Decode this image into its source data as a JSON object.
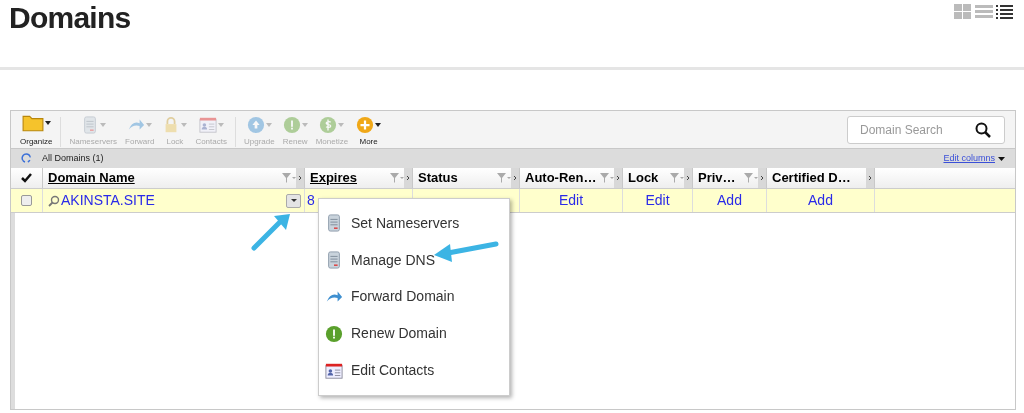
{
  "page": {
    "title": "Domains"
  },
  "view_toggles": [
    {
      "kind": "grid",
      "selected": false
    },
    {
      "kind": "list",
      "selected": false
    },
    {
      "kind": "detail",
      "selected": true
    }
  ],
  "toolbar": {
    "buttons": [
      {
        "kind": "folder",
        "label": "Organize",
        "disabled": false
      },
      {
        "kind": "server",
        "label": "Nameservers",
        "disabled": true
      },
      {
        "kind": "forward",
        "label": "Forward",
        "disabled": true
      },
      {
        "kind": "lock",
        "label": "Lock",
        "disabled": true
      },
      {
        "kind": "contacts",
        "label": "Contacts",
        "disabled": true
      },
      {
        "kind": "upgrade",
        "label": "Upgrade",
        "disabled": true
      },
      {
        "kind": "renew",
        "label": "Renew",
        "disabled": true
      },
      {
        "kind": "monetize",
        "label": "Monetize",
        "disabled": true
      },
      {
        "kind": "more",
        "label": "More",
        "disabled": false
      }
    ],
    "search": {
      "placeholder": "Domain Search"
    }
  },
  "list_bar": {
    "label": "All Domains (1)",
    "edit_columns": "Edit columns"
  },
  "table": {
    "columns": [
      {
        "label": "Domain Name",
        "underlined": true
      },
      {
        "label": "Expires",
        "underlined": true
      },
      {
        "label": "Status",
        "underlined": false
      },
      {
        "label": "Auto-Ren…",
        "underlined": false
      },
      {
        "label": "Lock",
        "underlined": false
      },
      {
        "label": "Priv…",
        "underlined": false
      },
      {
        "label": "Certified D…",
        "underlined": false
      }
    ],
    "rows": [
      {
        "checked": false,
        "domain": "AKINSTA.SITE",
        "expires": "8",
        "status": "",
        "auto_renew": "Edit",
        "lock": "Edit",
        "privacy": "Add",
        "certified": "Add"
      }
    ]
  },
  "context_menu": {
    "items": [
      {
        "kind": "server",
        "label": "Set Nameservers"
      },
      {
        "kind": "server",
        "label": "Manage DNS"
      },
      {
        "kind": "forward",
        "label": "Forward Domain"
      },
      {
        "kind": "renew",
        "label": "Renew Domain"
      },
      {
        "kind": "contacts",
        "label": "Edit Contacts"
      }
    ]
  }
}
